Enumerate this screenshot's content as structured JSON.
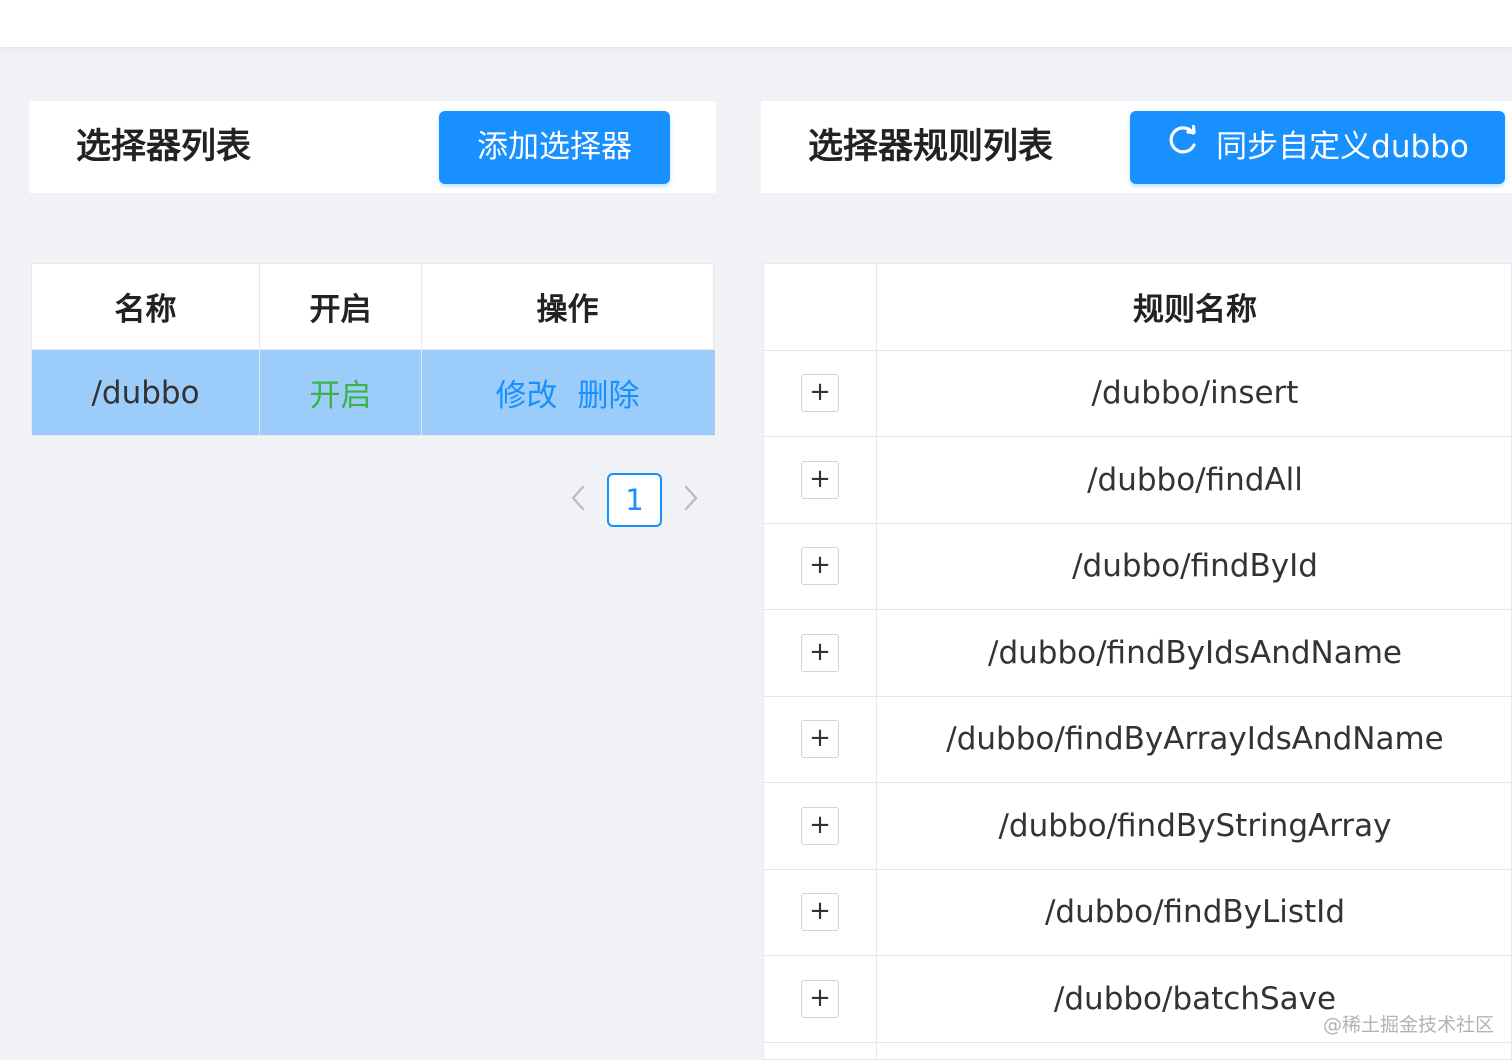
{
  "left_panel": {
    "title": "选择器列表",
    "add_button": "添加选择器",
    "columns": [
      "名称",
      "开启",
      "操作"
    ],
    "rows": [
      {
        "name": "/dubbo",
        "status": "开启",
        "edit": "修改",
        "delete": "删除"
      }
    ],
    "pagination": {
      "current_page": "1"
    }
  },
  "right_panel": {
    "title": "选择器规则列表",
    "sync_button": "同步自定义dubbo",
    "columns": [
      "",
      "规则名称"
    ],
    "expand_symbol": "+",
    "rules": [
      "/dubbo/insert",
      "/dubbo/findAll",
      "/dubbo/findById",
      "/dubbo/findByIdsAndName",
      "/dubbo/findByArrayIdsAndName",
      "/dubbo/findByStringArray",
      "/dubbo/findByListId",
      "/dubbo/batchSave"
    ]
  },
  "watermark": "@稀土掘金技术社区",
  "colors": {
    "primary": "#1890ff",
    "selected_row": "#9ccdfa",
    "status_on": "#3bb34a",
    "background": "#f0f2f5"
  }
}
